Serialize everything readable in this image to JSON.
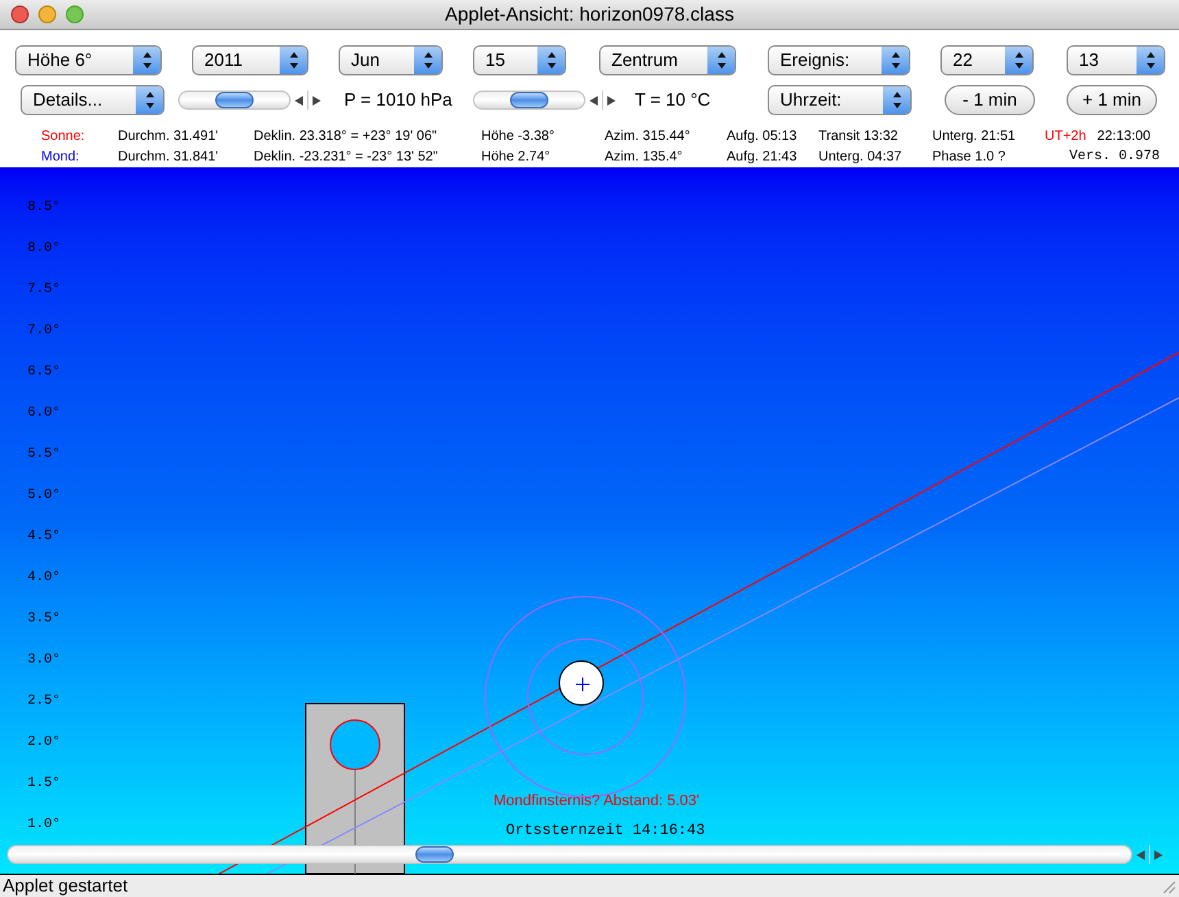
{
  "window": {
    "title": "Applet-Ansicht: horizon0978.class"
  },
  "controls": {
    "row1": [
      {
        "kind": "popup",
        "value": "Höhe 6°"
      },
      {
        "kind": "popup",
        "value": "2011"
      },
      {
        "kind": "popup",
        "value": "Jun"
      },
      {
        "kind": "popup",
        "value": "15"
      },
      {
        "kind": "popup",
        "value": "Zentrum"
      },
      {
        "kind": "popup",
        "value": "Ereignis:"
      },
      {
        "kind": "popup",
        "value": "22"
      },
      {
        "kind": "popup",
        "value": "13"
      }
    ],
    "row2": [
      {
        "kind": "popup",
        "value": "Details..."
      },
      {
        "kind": "slider",
        "level": 0.5
      },
      {
        "kind": "text",
        "value": "P = 1010 hPa"
      },
      {
        "kind": "slider",
        "level": 0.5
      },
      {
        "kind": "text",
        "value": "T = 10 °C"
      },
      {
        "kind": "popup",
        "value": "Uhrzeit:"
      },
      {
        "kind": "button",
        "value": "- 1 min"
      },
      {
        "kind": "button",
        "value": "+ 1 min"
      }
    ]
  },
  "info": [
    {
      "kind": "sun",
      "name": "Sonne:",
      "color": "#ff0000",
      "cells": [
        "Durchm. 31.491'",
        "Deklin. 23.318° = +23° 19' 06\"",
        "Höhe -3.38°",
        "Azim. 315.44°",
        "Aufg. 05:13",
        "Transit 13:32",
        "Unterg. 21:51"
      ],
      "zone": "UT+2h",
      "time": "22:13:00"
    },
    {
      "kind": "moon",
      "name": "Mond:",
      "color": "#0000ff",
      "cells": [
        "Durchm. 31.841'",
        "Deklin. -23.231° = -23° 13' 52\"",
        "Höhe 2.74°",
        "Azim. 135.4°",
        "Aufg. 21:43",
        "Unterg. 04:37",
        "Phase 1.0 ?"
      ],
      "version": "Vers. 0.978"
    }
  ],
  "sky": {
    "altitude_labels": [
      "8.5°",
      "8.0°",
      "7.5°",
      "7.0°",
      "6.5°",
      "6.0°",
      "5.5°",
      "5.0°",
      "4.5°",
      "4.0°",
      "3.5°",
      "3.0°",
      "2.5°",
      "2.0°",
      "1.5°",
      "1.0°"
    ],
    "eclipse_note": "Mondfinsternis? Abstand: 5.03'",
    "sidereal_time": "Ortssternzeit 14:16:43",
    "scrollbar": {
      "level": 0.38
    }
  },
  "status_bar": "Applet gestartet"
}
